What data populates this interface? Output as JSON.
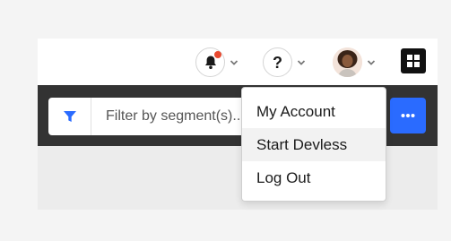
{
  "header": {
    "notifications": {
      "icon": "bell-icon",
      "has_unread": true,
      "dot_color": "#e8492f"
    },
    "help": {
      "icon": "question-icon",
      "symbol": "?"
    },
    "account": {
      "icon": "avatar"
    },
    "apps": {
      "icon": "grid-icon"
    }
  },
  "filter": {
    "icon": "filter-icon",
    "placeholder": "Filter by segment(s)...",
    "icon_color": "#2a6bff"
  },
  "more_button": {
    "icon": "more-horizontal-icon",
    "color": "#2a6bff"
  },
  "account_menu": {
    "items": [
      {
        "label": "My Account"
      },
      {
        "label": "Start Devless"
      },
      {
        "label": "Log Out"
      }
    ],
    "highlighted_index": 1
  }
}
